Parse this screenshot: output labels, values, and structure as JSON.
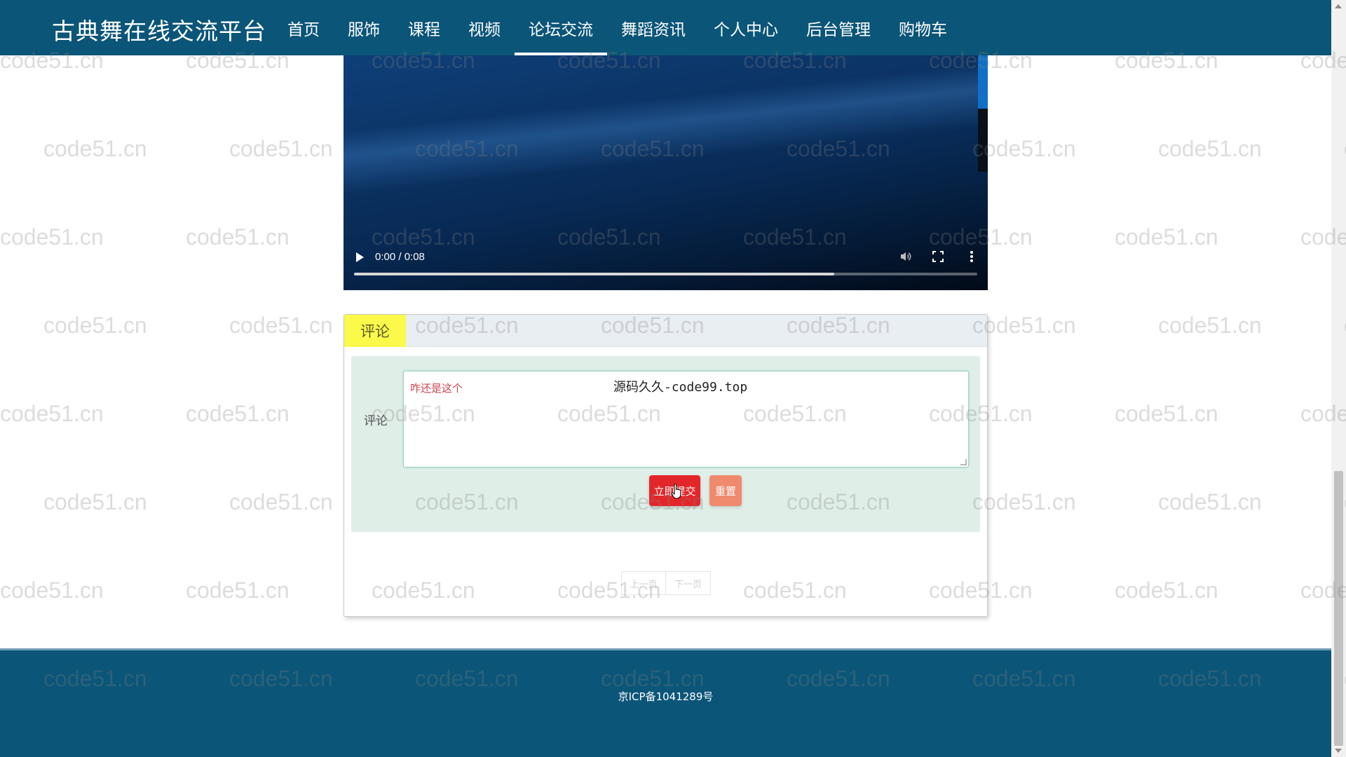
{
  "header": {
    "brand": "古典舞在线交流平台",
    "nav": [
      {
        "label": "首页",
        "active": false
      },
      {
        "label": "服饰",
        "active": false
      },
      {
        "label": "课程",
        "active": false
      },
      {
        "label": "视频",
        "active": false
      },
      {
        "label": "论坛交流",
        "active": true
      },
      {
        "label": "舞蹈资讯",
        "active": false
      },
      {
        "label": "个人中心",
        "active": false
      },
      {
        "label": "后台管理",
        "active": false
      },
      {
        "label": "购物车",
        "active": false
      }
    ]
  },
  "video": {
    "time": "0:00 / 0:08",
    "progress": 0.77
  },
  "comment": {
    "panel_title": "评论",
    "field_label": "评论",
    "text_value": "咋还是这个",
    "submit_label": "立即提交",
    "reset_label": "重置",
    "prev_label": "上一页",
    "next_label": "下一页"
  },
  "footer": {
    "icp": "京ICP备1041289号"
  },
  "watermark": {
    "text": "code51.cn",
    "overlay": "源码久久-code99.top"
  },
  "colors": {
    "nav_bg": "#0b5578",
    "title_tab": "#fbfa4a",
    "submit": "#e3262a",
    "reset": "#f08a6e"
  }
}
